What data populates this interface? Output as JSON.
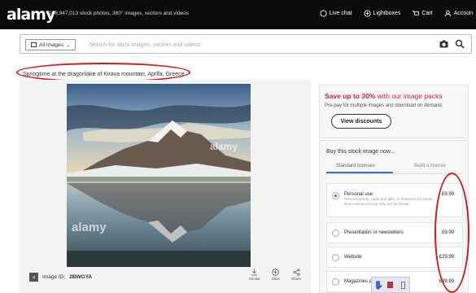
{
  "header": {
    "logo": "alamy",
    "tagline": "278,947,013 stock photos, 360° images, vectors and videos",
    "nav": {
      "live_chat": "Live chat",
      "lightboxes": "Lightboxes",
      "cart": "Cart",
      "account": "Accoun"
    }
  },
  "search": {
    "category": "All images",
    "placeholder": "Search for stock images, vectors and videos"
  },
  "caption": "Springtime at the dragonlake of Kirava mountain, Aprlfa, Greece",
  "image": {
    "watermark": "alamy",
    "id_label": "Image ID:",
    "id_value": "2BWGYA",
    "badge": "a",
    "tools": {
      "download": "Similar",
      "save": "Save",
      "share": "Share"
    }
  },
  "promo": {
    "title_prefix": "Save up to 30%",
    "title_suffix": " with our image packs",
    "subtitle": "Pre-pay for multiple images and download on demand.",
    "button": "View discounts"
  },
  "buy": {
    "title": "Buy this stock image now...",
    "tab_standard": "Standard licenses",
    "tab_rm": "Build a license",
    "options": [
      {
        "label": "Personal use",
        "price": "£9.99",
        "desc": "Personal prints, cards and gifts, or reference for artists. Non-commercial use only, not for resale."
      },
      {
        "label": "Presentation or newsletters",
        "price": "£9.99"
      },
      {
        "label": "Website",
        "price": "£29.99"
      },
      {
        "label": "Magazines and books",
        "price": "£49.99"
      }
    ]
  },
  "colors": {
    "annotation_red": "#d21a1a",
    "promo_pink": "#d0204f",
    "accent_blue": "#3a6fd8"
  }
}
